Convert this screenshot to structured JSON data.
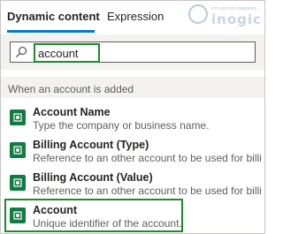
{
  "tabs": {
    "dynamic_content": "Dynamic content",
    "expression": "Expression"
  },
  "logo": {
    "tagline": "crm and erp integration",
    "brand": "inogic"
  },
  "search": {
    "value": "account",
    "icon": "search-icon"
  },
  "section": {
    "title": "When an account is added"
  },
  "items": [
    {
      "name": "Account Name",
      "description": "Type the company or business name."
    },
    {
      "name": "Billing Account (Type)",
      "description": "Reference to an other account to be used for billing (only..."
    },
    {
      "name": "Billing Account (Value)",
      "description": "Reference to an other account to be used for billing (only..."
    },
    {
      "name": "Account",
      "description": "Unique identifier of the account."
    }
  ],
  "colors": {
    "accent": "#0078d4",
    "highlight": "#1f8a2c",
    "item_icon": "#107c41"
  }
}
